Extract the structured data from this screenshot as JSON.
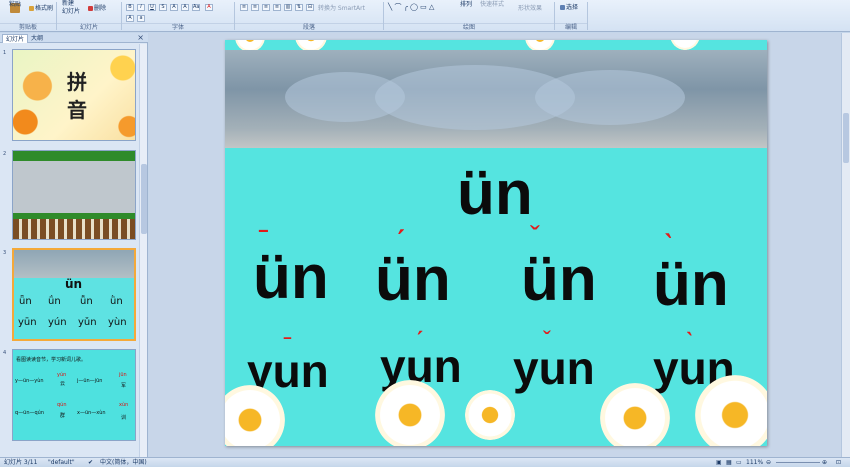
{
  "ribbon": {
    "paste_label": "粘贴",
    "format_painter_label": "格式刷",
    "new_slide_label": "新建\n幻灯片",
    "delete_label": "删除",
    "convert_smartart_label": "转换为 SmartArt",
    "arrange_label": "排列",
    "quick_styles_label": "快速样式",
    "shape_effects_label": "形状效果",
    "select_label": "选择",
    "groups": {
      "clipboard": "剪贴板",
      "slides": "幻灯片",
      "font": "字体",
      "paragraph": "段落",
      "drawing": "绘图",
      "editing": "编辑"
    }
  },
  "pane": {
    "tabs": [
      "幻灯片",
      "大纲"
    ],
    "close": "×",
    "slide_numbers": [
      "1",
      "2",
      "3",
      "4"
    ],
    "thumb1": {
      "chars": [
        "拼",
        "音"
      ]
    },
    "thumb3": {
      "title": "ün",
      "row1": [
        "ǖn",
        "ǘn",
        "ǚn",
        "ǜn"
      ],
      "row2": [
        "yūn",
        "yún",
        "yǔn",
        "yùn"
      ]
    },
    "thumb4": {
      "header": "看图读读音节，学习新词儿歌。",
      "lines": [
        {
          "a": "y—ün—yùn",
          "b": "yún",
          "c": "云"
        },
        {
          "a": "j—ün—jūn",
          "b": "jūn",
          "c": "军"
        },
        {
          "a": "q—ün—qún",
          "b": "qún",
          "c": "群"
        },
        {
          "a": "x—ün—xùn",
          "b": "xùn",
          "c": "训"
        }
      ]
    }
  },
  "slide": {
    "title": "ün",
    "row1": [
      {
        "base": "ün",
        "mark": "ˉ"
      },
      {
        "base": "ün",
        "mark": "ˊ"
      },
      {
        "base": "ün",
        "mark": "ˇ"
      },
      {
        "base": "ün",
        "mark": "ˋ"
      }
    ],
    "row2": [
      {
        "base": "yun",
        "mark": "ˉ"
      },
      {
        "base": "yun",
        "mark": "ˊ"
      },
      {
        "base": "yun",
        "mark": "ˇ"
      },
      {
        "base": "yun",
        "mark": "ˋ"
      }
    ]
  },
  "status": {
    "slide_counter": "幻灯片 3/11",
    "theme": "\"default\"",
    "language": "中文(简体，中国)",
    "zoom": "111%"
  },
  "colors": {
    "slide_bg": "#55e4e0",
    "tone_mark": "#e21b1b",
    "selection": "#f4a93a"
  }
}
